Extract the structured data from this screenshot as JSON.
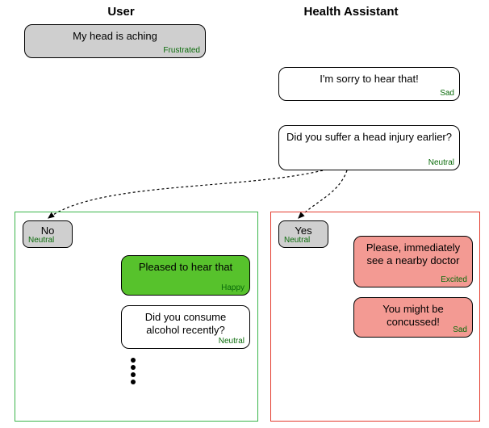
{
  "headers": {
    "user": "User",
    "assistant": "Health Assistant"
  },
  "top": {
    "user1": {
      "text": "My head is aching",
      "emotion": "Frustrated"
    },
    "assist1": {
      "text": "I'm sorry to hear that!",
      "emotion": "Sad"
    },
    "assist2": {
      "text": "Did you suffer a head injury earlier?",
      "emotion": "Neutral"
    }
  },
  "branch_no": {
    "answer": {
      "text": "No",
      "emotion": "Neutral"
    },
    "reply1": {
      "text": "Pleased to hear that",
      "emotion": "Happy"
    },
    "reply2": {
      "text": "Did you consume alcohol recently?",
      "emotion": "Neutral"
    }
  },
  "branch_yes": {
    "answer": {
      "text": "Yes",
      "emotion": "Neutral"
    },
    "reply1": {
      "text": "Please, immediately see a nearby doctor",
      "emotion": "Excited"
    },
    "reply2": {
      "text": "You might be concussed!",
      "emotion": "Sad"
    }
  },
  "colors": {
    "grey": "#cfcfcf",
    "green_fill": "#57c22c",
    "red_fill": "#f39a93",
    "green_border": "#3ab54a",
    "red_border": "#e33b2e",
    "emotion_text": "#0a6b0a"
  }
}
